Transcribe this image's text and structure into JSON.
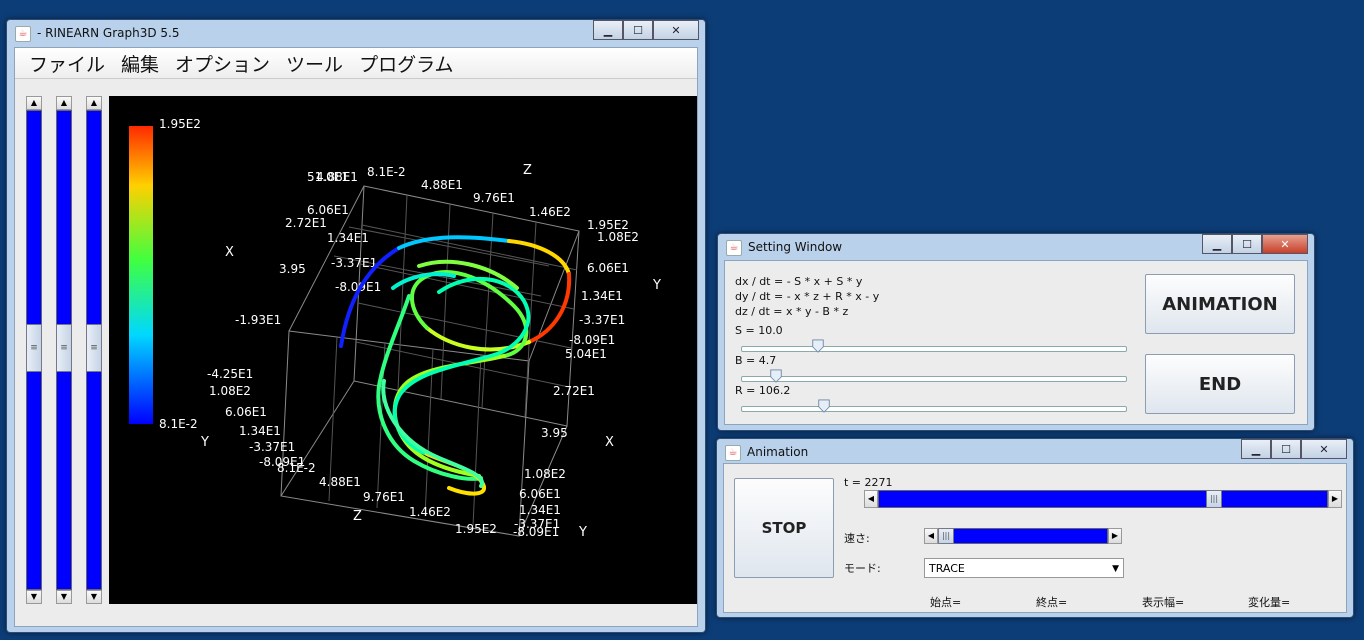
{
  "main_window": {
    "title": "- RINEARN Graph3D 5.5",
    "menu": [
      "ファイル",
      "編集",
      "オプション",
      "ツール",
      "プログラム"
    ]
  },
  "colorbar": {
    "max": "1.95E2",
    "min": "8.1E-2"
  },
  "axis_labels": [
    {
      "t": "51.0E1"
    },
    {
      "t": "4.88E1"
    },
    {
      "t": "8.1E-2"
    },
    {
      "t": "4.88E1"
    },
    {
      "t": "9.76E1"
    },
    {
      "t": "1.46E2"
    },
    {
      "t": "1.95E2"
    },
    {
      "t": "1.08E2"
    },
    {
      "t": "6.06E1"
    },
    {
      "t": "2.72E1"
    },
    {
      "t": "1.34E1"
    },
    {
      "t": "-3.37E1"
    },
    {
      "t": "3.95"
    },
    {
      "t": "-8.09E1"
    },
    {
      "t": "-1.93E1"
    },
    {
      "t": "6.06E1"
    },
    {
      "t": "1.34E1"
    },
    {
      "t": "-3.37E1"
    },
    {
      "t": "-8.09E1"
    },
    {
      "t": "5.04E1"
    },
    {
      "t": "2.72E1"
    },
    {
      "t": "3.95"
    },
    {
      "t": "-4.25E1"
    },
    {
      "t": "1.08E2"
    },
    {
      "t": "6.06E1"
    },
    {
      "t": "1.34E1"
    },
    {
      "t": "-3.37E1"
    },
    {
      "t": "-8.09E1"
    },
    {
      "t": "8.1E-2"
    },
    {
      "t": "4.88E1"
    },
    {
      "t": "9.76E1"
    },
    {
      "t": "1.46E2"
    },
    {
      "t": "1.95E2"
    },
    {
      "t": "1.08E2"
    },
    {
      "t": "6.06E1"
    },
    {
      "t": "1.34E1"
    },
    {
      "t": "-3.37E1"
    },
    {
      "t": "-8.09E1"
    }
  ],
  "axis_names": [
    "Z",
    "X",
    "Y",
    "Y",
    "X",
    "Z",
    "Y"
  ],
  "setting_window": {
    "title": "Setting Window",
    "eq1": "dx / dt = - S * x + S * y",
    "eq2": "dy / dt = - x * z + R * x - y",
    "eq3": "dz / dt = x * y - B * z",
    "s_label": "S = 10.0",
    "b_label": "B = 4.7",
    "r_label": "R = 106.2",
    "animation_button": "ANIMATION",
    "end_button": "END"
  },
  "animation_window": {
    "title": "Animation",
    "t_label": "t = 2271",
    "stop_button": "STOP",
    "speed_label": "速さ:",
    "mode_label": "モード:",
    "mode_value": "TRACE",
    "start_label": "始点=",
    "end_label": "終点=",
    "width_label": "表示幅=",
    "delta_label": "変化量="
  },
  "colors": {
    "desktop": "#0d3d77",
    "slider_track": "#0000ff",
    "plot_bg": "#000000"
  }
}
